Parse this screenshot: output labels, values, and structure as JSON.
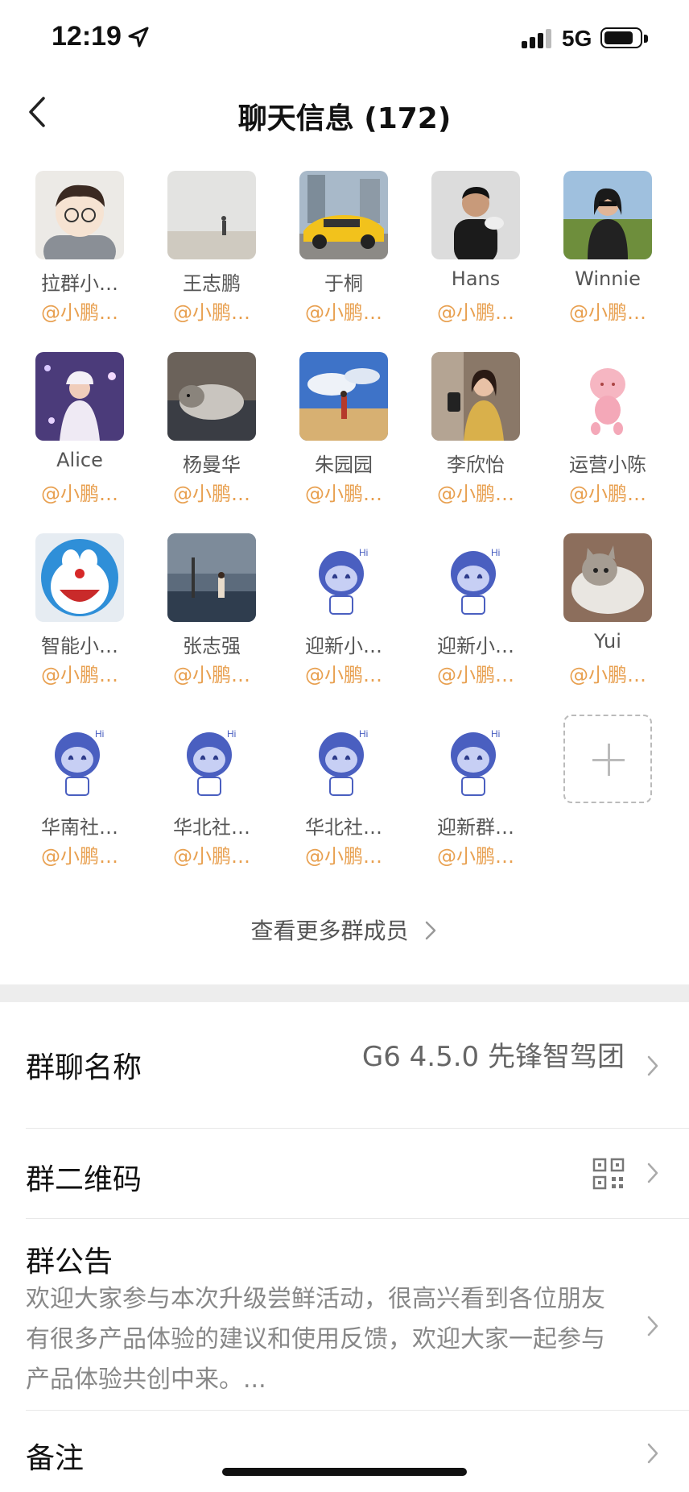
{
  "status_bar": {
    "time": "12:19",
    "network": "5G"
  },
  "nav": {
    "title": "聊天信息 (172)"
  },
  "members": [
    {
      "name": "拉群小…",
      "tag": "@小鹏…",
      "avatar": "cartoon-boy"
    },
    {
      "name": "王志鹏",
      "tag": "@小鹏…",
      "avatar": "beach-walk"
    },
    {
      "name": "于桐",
      "tag": "@小鹏…",
      "avatar": "yellow-car"
    },
    {
      "name": "Hans",
      "tag": "@小鹏…",
      "avatar": "man-portrait"
    },
    {
      "name": "Winnie",
      "tag": "@小鹏…",
      "avatar": "woman-outdoor"
    },
    {
      "name": "Alice",
      "tag": "@小鹏…",
      "avatar": "woman-purple"
    },
    {
      "name": "杨曼华",
      "tag": "@小鹏…",
      "avatar": "cat-sleeping"
    },
    {
      "name": "朱园园",
      "tag": "@小鹏…",
      "avatar": "desert-sky"
    },
    {
      "name": "李欣怡",
      "tag": "@小鹏…",
      "avatar": "woman-mirror"
    },
    {
      "name": "运营小陈",
      "tag": "@小鹏…",
      "avatar": "pink-figure"
    },
    {
      "name": "智能小…",
      "tag": "@小鹏…",
      "avatar": "doraemon"
    },
    {
      "name": "张志强",
      "tag": "@小鹏…",
      "avatar": "sea-pier"
    },
    {
      "name": "迎新小…",
      "tag": "@小鹏…",
      "avatar": "robot-hi"
    },
    {
      "name": "迎新小…",
      "tag": "@小鹏…",
      "avatar": "robot-hi"
    },
    {
      "name": "Yui",
      "tag": "@小鹏…",
      "avatar": "cat-white"
    },
    {
      "name": "华南社…",
      "tag": "@小鹏…",
      "avatar": "robot-hi"
    },
    {
      "name": "华北社…",
      "tag": "@小鹏…",
      "avatar": "robot-hi"
    },
    {
      "name": "华北社…",
      "tag": "@小鹏…",
      "avatar": "robot-hi"
    },
    {
      "name": "迎新群…",
      "tag": "@小鹏…",
      "avatar": "robot-hi"
    }
  ],
  "more_members_label": "查看更多群成员",
  "settings": {
    "group_name_label": "群聊名称",
    "group_name_value": "G6 4.5.0 先锋智驾团",
    "qr_label": "群二维码",
    "notice_label": "群公告",
    "notice_text": "欢迎大家参与本次升级尝鲜活动，很高兴看到各位朋友有很多产品体验的建议和使用反馈，欢迎大家一起参与产品体验共创中来。...",
    "remark_label": "备注"
  },
  "colors": {
    "accent_tag": "#e8a050",
    "divider": "#e8e8e8",
    "band": "#ededed"
  }
}
